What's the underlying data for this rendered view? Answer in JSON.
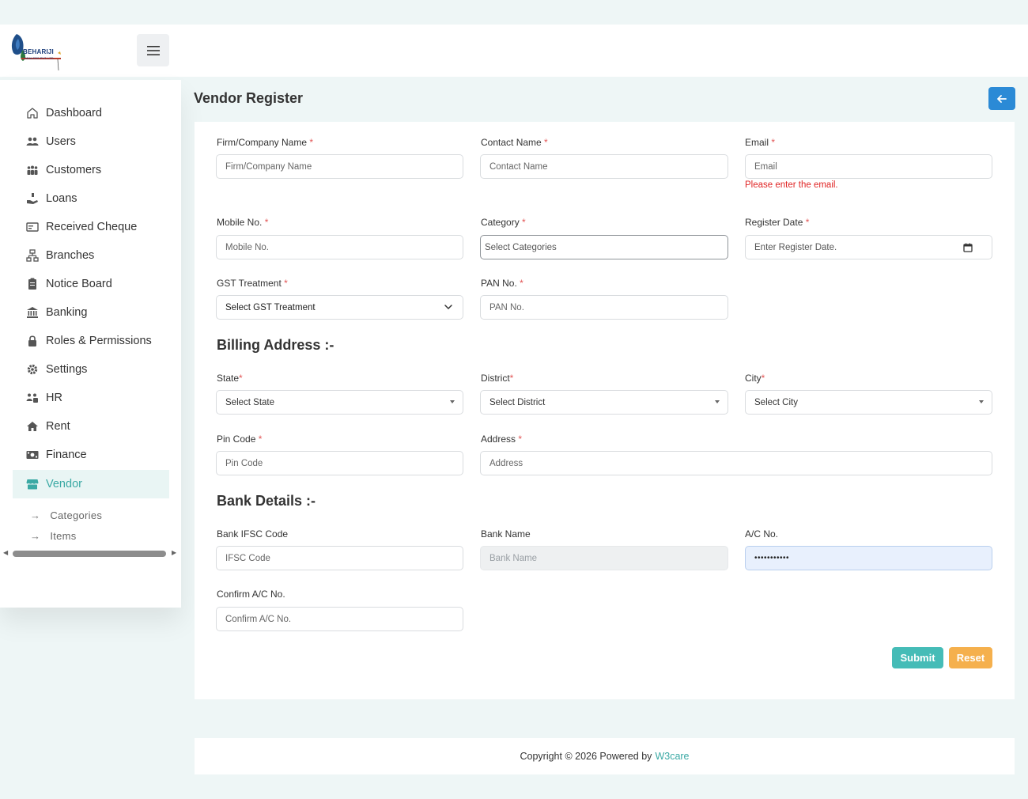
{
  "brand": {
    "logo_text": "BEHARIJI",
    "logo_subtext": "DEALERS PVT. LTD."
  },
  "sidebar": {
    "items": [
      {
        "label": "Dashboard",
        "icon": "home-icon"
      },
      {
        "label": "Users",
        "icon": "users-icon"
      },
      {
        "label": "Customers",
        "icon": "customers-icon"
      },
      {
        "label": "Loans",
        "icon": "loans-icon"
      },
      {
        "label": "Received Cheque",
        "icon": "cheque-icon"
      },
      {
        "label": "Branches",
        "icon": "branches-icon"
      },
      {
        "label": "Notice Board",
        "icon": "notice-icon"
      },
      {
        "label": "Banking",
        "icon": "bank-icon"
      },
      {
        "label": "Roles & Permissions",
        "icon": "lock-icon"
      },
      {
        "label": "Settings",
        "icon": "gear-icon"
      },
      {
        "label": "HR",
        "icon": "hr-icon"
      },
      {
        "label": "Rent",
        "icon": "house-icon"
      },
      {
        "label": "Finance",
        "icon": "money-icon"
      },
      {
        "label": "Vendor",
        "icon": "store-icon",
        "active": true
      }
    ],
    "subitems": [
      {
        "label": "Categories"
      },
      {
        "label": "Items"
      }
    ]
  },
  "page": {
    "title": "Vendor Register"
  },
  "form": {
    "firm_label": "Firm/Company Name",
    "firm_placeholder": "Firm/Company Name",
    "contact_label": "Contact Name",
    "contact_placeholder": "Contact Name",
    "email_label": "Email",
    "email_placeholder": "Email",
    "email_error": "Please enter the email.",
    "mobile_label": "Mobile No.",
    "mobile_placeholder": "Mobile No.",
    "category_label": "Category",
    "category_placeholder": "Select Categories",
    "register_label": "Register Date",
    "register_placeholder": "Enter Register Date.",
    "gst_label": "GST Treatment",
    "gst_value": "Select GST Treatment",
    "pan_label": "PAN No.",
    "pan_placeholder": "PAN No.",
    "billing_title": "Billing Address :-",
    "state_label": "State",
    "state_value": "Select State",
    "district_label": "District",
    "district_value": "Select District",
    "city_label": "City",
    "city_value": "Select City",
    "pin_label": "Pin Code",
    "pin_placeholder": "Pin Code",
    "address_label": "Address",
    "address_placeholder": "Address",
    "bank_title": "Bank Details :-",
    "ifsc_label": "Bank IFSC Code",
    "ifsc_placeholder": "IFSC Code",
    "bankname_label": "Bank Name",
    "bankname_placeholder": "Bank Name",
    "ac_label": "A/C No.",
    "ac_value": "•••••••••••",
    "confirm_label": "Confirm A/C No.",
    "confirm_placeholder": "Confirm A/C No.",
    "required_mark": "*",
    "submit": "Submit",
    "reset": "Reset"
  },
  "footer": {
    "text": "Copyright © 2026 Powered by",
    "link": "W3care"
  },
  "colors": {
    "accent": "#3aa9a4",
    "primary": "#2b8ad6",
    "submit": "#45bcb7",
    "reset": "#f5b04d",
    "error": "#e02424"
  }
}
